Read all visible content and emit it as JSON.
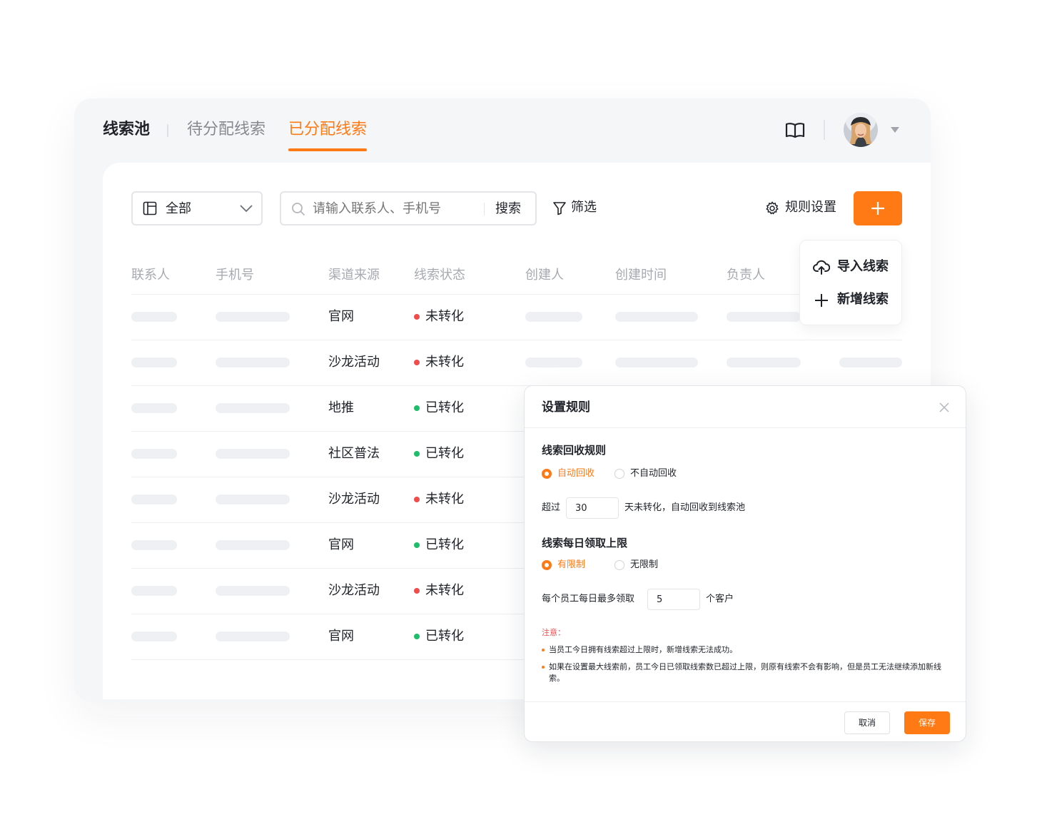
{
  "tabs": {
    "brand": "线索池",
    "pending": "待分配线索",
    "assigned": "已分配线索"
  },
  "header": {
    "guide_icon": "open-book-icon",
    "avatar_icon": "user-avatar",
    "menu_icon": "caret-down-icon"
  },
  "toolbar": {
    "scope_value": "全部",
    "search_placeholder": "请输入联系人、手机号",
    "search_button": "搜索",
    "filter_label": "筛选",
    "rules_label": "规则设置",
    "add_icon": "plus-icon"
  },
  "add_menu": {
    "import_label": "导入线索",
    "new_label": "新增线索"
  },
  "table": {
    "columns": [
      "联系人",
      "手机号",
      "渠道来源",
      "线索状态",
      "创建人",
      "创建时间",
      "负责人"
    ],
    "rows": [
      {
        "source": "官网",
        "status": "未转化",
        "state": "unconverted"
      },
      {
        "source": "沙龙活动",
        "status": "未转化",
        "state": "unconverted"
      },
      {
        "source": "地推",
        "status": "已转化",
        "state": "converted"
      },
      {
        "source": "社区普法",
        "status": "已转化",
        "state": "converted"
      },
      {
        "source": "沙龙活动",
        "status": "未转化",
        "state": "unconverted"
      },
      {
        "source": "官网",
        "status": "已转化",
        "state": "converted"
      },
      {
        "source": "沙龙活动",
        "status": "未转化",
        "state": "unconverted"
      },
      {
        "source": "官网",
        "status": "已转化",
        "state": "converted"
      }
    ]
  },
  "colors": {
    "accent": "#ff7a14",
    "converted": "#1fbf6a",
    "unconverted": "#f04c4c"
  },
  "modal": {
    "title": "设置规则",
    "recycle_title": "线索回收规则",
    "recycle_auto": "自动回收",
    "recycle_manual": "不自动回收",
    "recycle_prefix": "超过",
    "recycle_days": "30",
    "recycle_suffix": "天未转化，自动回收到线索池",
    "limit_title": "线索每日领取上限",
    "limit_on": "有限制",
    "limit_off": "无限制",
    "limit_prefix": "每个员工每日最多领取",
    "limit_value": "5",
    "limit_suffix": "个客户",
    "note_title": "注意：",
    "note_1": "当员工今日拥有线索超过上限时，新增线索无法成功。",
    "note_2": "如果在设置最大线索前，员工今日已领取线索数已超过上限，则原有线索不会有影响，但是员工无法继续添加新线索。",
    "cancel": "取消",
    "save": "保存"
  }
}
